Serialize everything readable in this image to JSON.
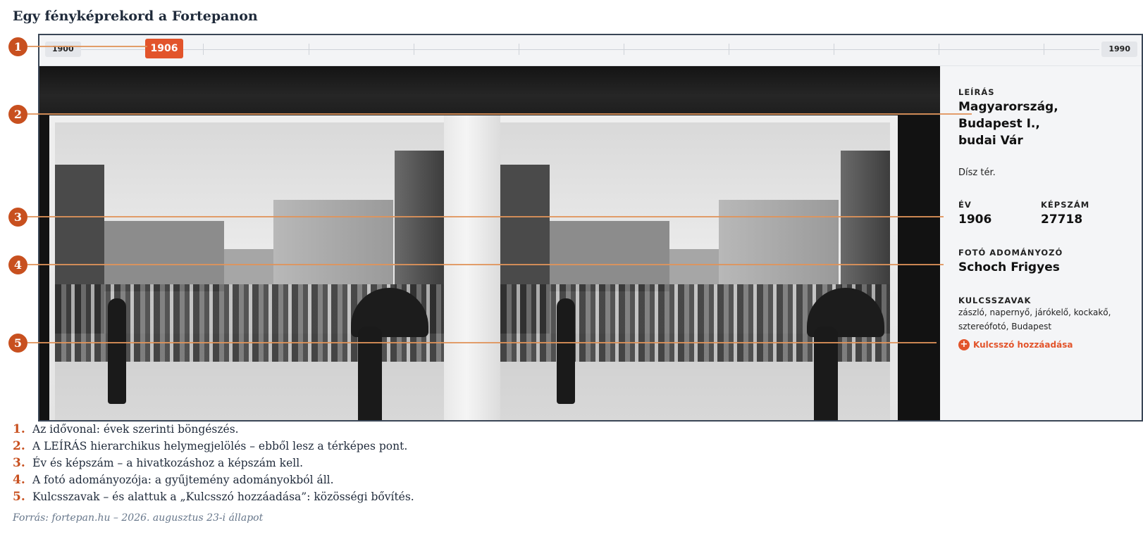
{
  "page_title": "Egy fényképrekord a Fortepanon",
  "timeline": {
    "start_year": "1900",
    "selected_year": "1906",
    "end_year": "1990"
  },
  "photo": {
    "description": "Sztereófotó: két szinte azonos, fekete-fehér utcakép a budai Várból, sétáló emberekkel és napernyőkkel."
  },
  "panel": {
    "description_label": "LEÍRÁS",
    "location_line1": "Magyarország,",
    "location_line2": "Budapest I.,",
    "location_line3": "budai Vár",
    "place": "Dísz tér.",
    "year_label": "ÉV",
    "year_value": "1906",
    "id_label": "KÉPSZÁM",
    "id_value": "27718",
    "donor_label": "FOTÓ ADOMÁNYOZÓ",
    "donor_value": "Schoch Frigyes",
    "keywords_label": "KULCSSZAVAK",
    "keywords_line1": "zászló, napernyő, járókelő, kockakő,",
    "keywords_line2": "sztereófotó, Budapest",
    "add_keyword_label": "Kulcsszó hozzáadása"
  },
  "callouts": [
    "1",
    "2",
    "3",
    "4",
    "5"
  ],
  "notes": [
    {
      "num": "1.",
      "text": "Az idővonal: évek szerinti böngészés."
    },
    {
      "num": "2.",
      "text": "A LEÍRÁS hierarchikus helymegjelölés – ebből lesz a térképes pont."
    },
    {
      "num": "3.",
      "text": "Év és képszám – a hivatkozáshoz a képszám kell."
    },
    {
      "num": "4.",
      "text": "A fotó adományozója: a gyűjtemény adományokból áll."
    },
    {
      "num": "5.",
      "text": "Kulcsszavak – és alattuk a „Kulcsszó hozzáadása”: közösségi bővítés."
    }
  ],
  "source": "Forrás: fortepan.hu – 2026. augusztus 23-i állapot",
  "colors": {
    "accent": "#e2542b",
    "callout": "#c8501f",
    "frame": "#3a4656"
  }
}
